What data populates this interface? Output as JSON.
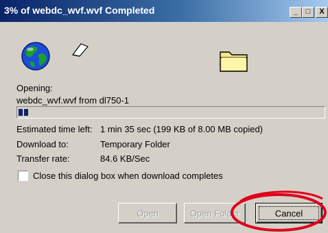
{
  "window": {
    "title": "3% of webdc_wvf.wvf Completed",
    "controls": {
      "minimize": "_",
      "maximize": "□",
      "close": "X"
    }
  },
  "status": {
    "opening_label": "Opening:",
    "opening_value": "webdc_wvf.wvf from dl750-1",
    "progress_fraction": 0.03
  },
  "details": {
    "time_left_label": "Estimated time left:",
    "time_left_value": "1 min 35 sec (199 KB of 8.00 MB copied)",
    "download_to_label": "Download to:",
    "download_to_value": "Temporary Folder",
    "transfer_rate_label": "Transfer rate:",
    "transfer_rate_value": "84.6 KB/Sec"
  },
  "options": {
    "close_when_done_label": "Close this dialog box when download completes",
    "close_when_done_checked": false
  },
  "buttons": {
    "open": "Open",
    "open_folder": "Open Folder",
    "cancel": "Cancel"
  },
  "icons": [
    "globe-icon",
    "paper-document-icon",
    "folder-icon"
  ],
  "colors": {
    "title_bar": "#0a246a",
    "progress": "#0a246a",
    "annotation_circle": "#e0001b"
  }
}
